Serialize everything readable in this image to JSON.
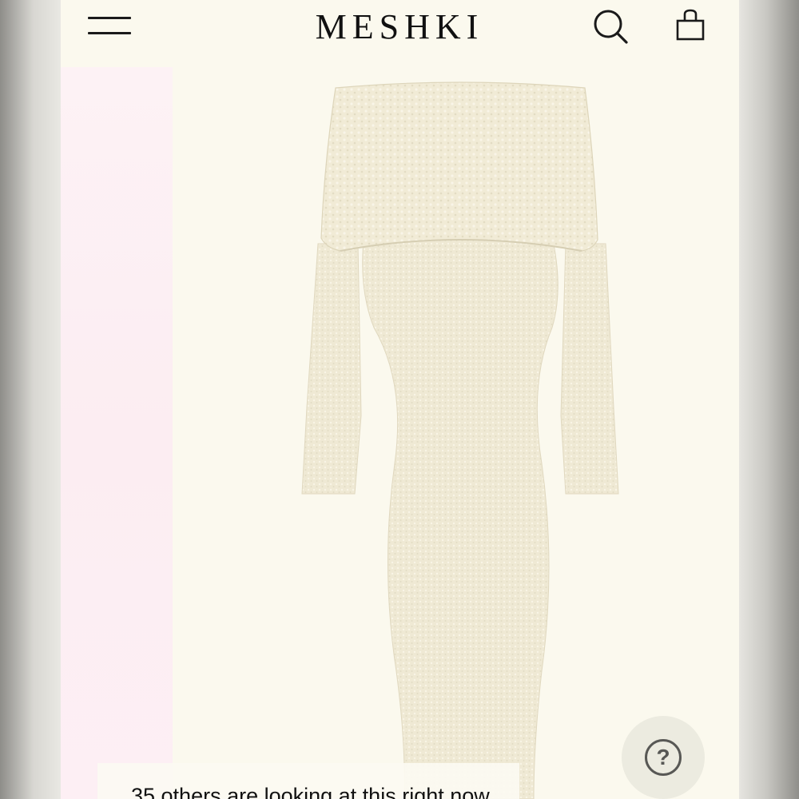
{
  "header": {
    "brand": "MESHKI",
    "menu_icon": "hamburger-menu-icon",
    "search_icon": "search-icon",
    "bag_icon": "shopping-bag-icon"
  },
  "product": {
    "image_icon": "off-shoulder-knit-maxi-dress",
    "image_color": "#efe9d3"
  },
  "social_proof": {
    "text": "35 others are looking at this right now"
  },
  "help": {
    "icon": "question-mark-icon",
    "label": "?"
  },
  "colors": {
    "page_bg": "#fbf9ee",
    "accent_text": "#111111",
    "pink_panel": "#fcedf2"
  }
}
